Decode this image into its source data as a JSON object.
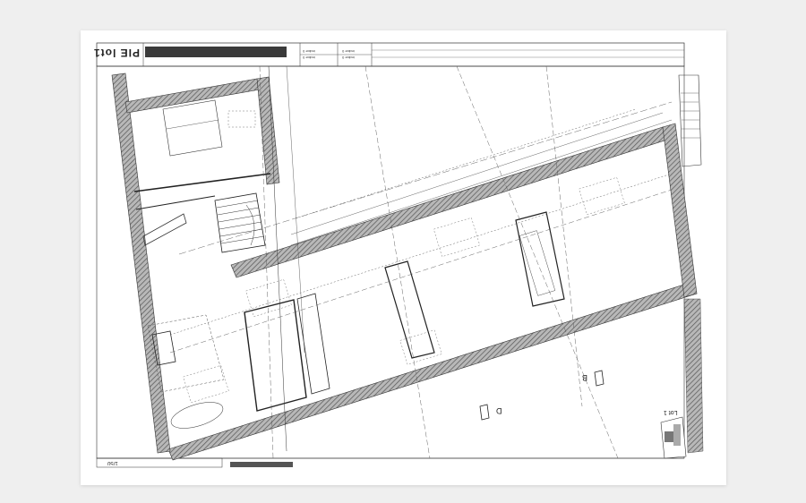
{
  "sheet": {
    "title": "PIE lot1",
    "scale": "1/50",
    "title_band": "",
    "footer_band": "",
    "revisions": [
      "indice 0",
      "indice 0",
      "indice 0",
      "indice 0"
    ],
    "description_lines": [
      "",
      "",
      ""
    ],
    "note": "",
    "section_labels": [
      "B",
      "D"
    ],
    "keyplan_label": "Lot 1"
  },
  "colors": {
    "page_background": "#efefef",
    "sheet": "#ffffff",
    "wall_hatch": "#8a8a8a",
    "lines": "#222222"
  }
}
